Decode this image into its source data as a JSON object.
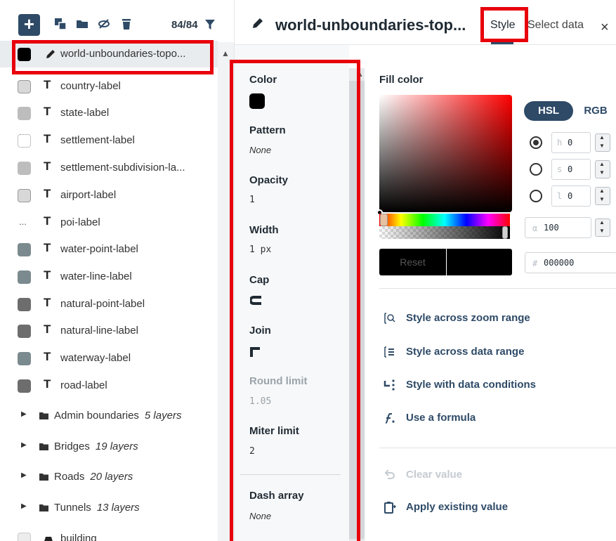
{
  "toolbar": {
    "add_label": "+",
    "layer_counter": "84/84"
  },
  "layers": [
    {
      "name": "world-unboundaries-topo...",
      "type_icon": "pencil-icon",
      "swatch_color": "#000000",
      "selected": true
    },
    {
      "name": "country-label",
      "type_icon": "T",
      "swatch_color": "#bdbdbd"
    },
    {
      "name": "state-label",
      "type_icon": "T",
      "swatch_color": "#bdbdbd"
    },
    {
      "name": "settlement-label",
      "type_icon": "T",
      "swatch_color": "#bdbdbd"
    },
    {
      "name": "settlement-subdivision-la...",
      "type_icon": "T",
      "swatch_color": "#bdbdbd"
    },
    {
      "name": "airport-label",
      "type_icon": "T",
      "swatch_color": "#bdbdbd"
    },
    {
      "name": "poi-label",
      "type_icon": "T",
      "swatch_color": "#ffffff"
    },
    {
      "name": "water-point-label",
      "type_icon": "T",
      "swatch_color": "#7b8a8f"
    },
    {
      "name": "water-line-label",
      "type_icon": "T",
      "swatch_color": "#7b8a8f"
    },
    {
      "name": "natural-point-label",
      "type_icon": "T",
      "swatch_color": "#6d6d6d"
    },
    {
      "name": "natural-line-label",
      "type_icon": "T",
      "swatch_color": "#6d6d6d"
    },
    {
      "name": "waterway-label",
      "type_icon": "T",
      "swatch_color": "#7b8a8f"
    },
    {
      "name": "road-label",
      "type_icon": "T",
      "swatch_color": "#6d6d6d"
    }
  ],
  "groups": [
    {
      "name": "Admin boundaries",
      "count": "5 layers"
    },
    {
      "name": "Bridges",
      "count": "19 layers"
    },
    {
      "name": "Roads",
      "count": "20 layers"
    },
    {
      "name": "Tunnels",
      "count": "13 layers"
    }
  ],
  "last_layer": {
    "name": "building"
  },
  "header": {
    "layer_title": "world-unboundaries-top...",
    "tab_style": "Style",
    "tab_select_data": "Select data",
    "close_label": "×"
  },
  "properties": {
    "color_label": "Color",
    "pattern_label": "Pattern",
    "pattern_value": "None",
    "opacity_label": "Opacity",
    "opacity_value": "1",
    "width_label": "Width",
    "width_value": "1 px",
    "cap_label": "Cap",
    "join_label": "Join",
    "round_limit_label": "Round limit",
    "round_limit_value": "1.05",
    "miter_limit_label": "Miter limit",
    "miter_limit_value": "2",
    "dash_array_label": "Dash array",
    "dash_array_value": "None"
  },
  "editor": {
    "fill_color_label": "Fill color",
    "mode_hsl": "HSL",
    "mode_rgb": "RGB",
    "h_prefix": "h",
    "h_value": "0",
    "s_prefix": "s",
    "s_value": "0",
    "l_prefix": "l",
    "l_value": "0",
    "alpha_prefix": "α",
    "alpha_value": "100",
    "hex_prefix": "#",
    "hex_value": "000000",
    "reset_label": "Reset",
    "current_color": "#000000"
  },
  "actions": {
    "zoom_range": "Style across zoom range",
    "data_range": "Style across data range",
    "data_conditions": "Style with data conditions",
    "formula": "Use a formula",
    "clear_value": "Clear value",
    "apply_existing": "Apply existing value"
  },
  "colors": {
    "accent": "#2e4a67",
    "highlight_box": "#e8000b"
  }
}
